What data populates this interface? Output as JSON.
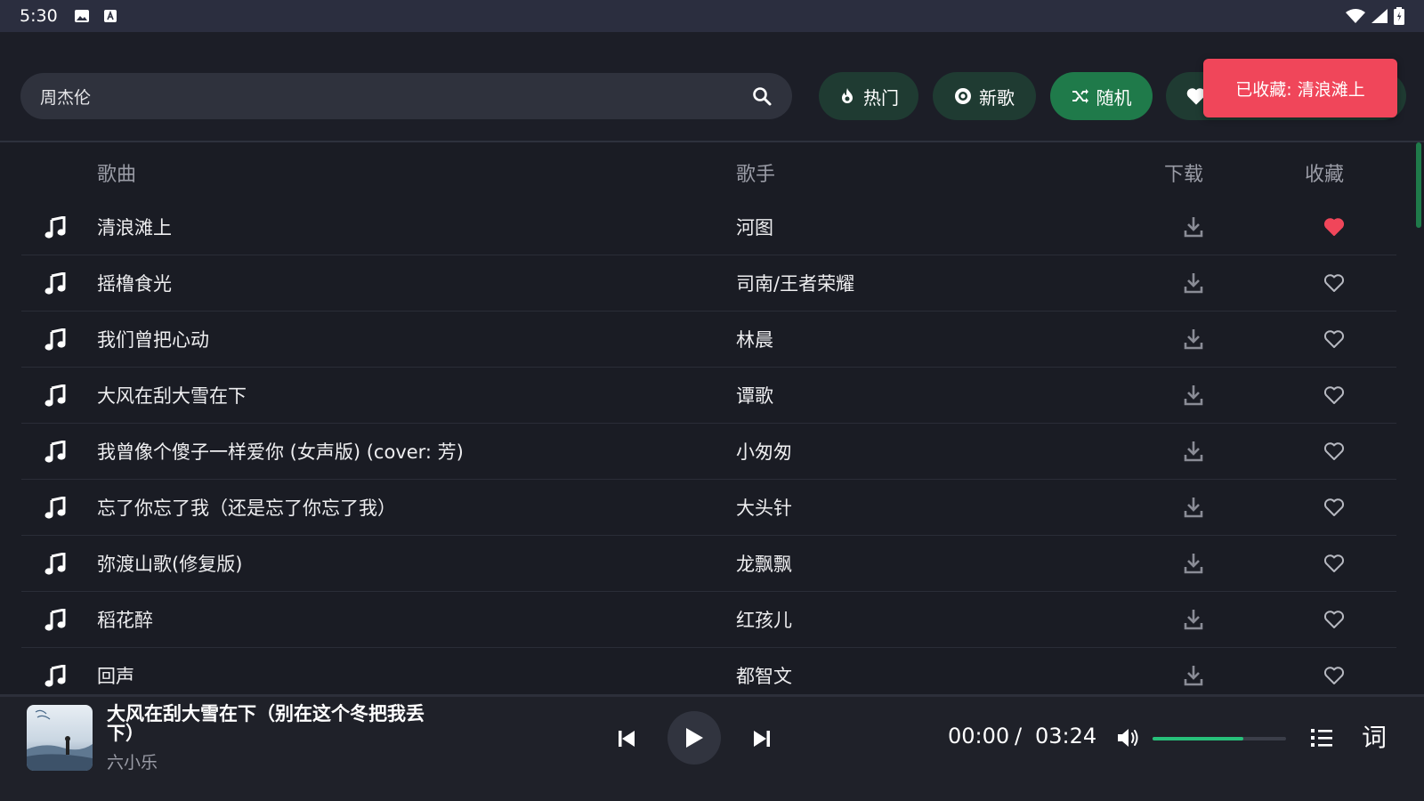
{
  "status_bar": {
    "time": "5:30"
  },
  "search": {
    "value": "周杰伦"
  },
  "filters": [
    {
      "label": "热门",
      "icon": "fire-icon"
    },
    {
      "label": "新歌",
      "icon": "disc-icon"
    },
    {
      "label": "随机",
      "icon": "shuffle-icon",
      "active": true
    },
    {
      "label": "",
      "icon": "heart-icon"
    }
  ],
  "toast": {
    "text": "已收藏: 清浪滩上"
  },
  "table": {
    "headers": {
      "song": "歌曲",
      "artist": "歌手",
      "download": "下载",
      "favorite": "收藏"
    },
    "rows": [
      {
        "title": "清浪滩上",
        "artist": "河图",
        "favorited": true
      },
      {
        "title": "摇橹食光",
        "artist": "司南/王者荣耀",
        "favorited": false
      },
      {
        "title": "我们曾把心动",
        "artist": "林晨",
        "favorited": false
      },
      {
        "title": "大风在刮大雪在下",
        "artist": "谭歌",
        "favorited": false
      },
      {
        "title": "我曾像个傻子一样爱你 (女声版) (cover: 芳)",
        "artist": "小匆匆",
        "favorited": false
      },
      {
        "title": "忘了你忘了我（还是忘了你忘了我）",
        "artist": "大头针",
        "favorited": false
      },
      {
        "title": "弥渡山歌(修复版)",
        "artist": "龙飘飘",
        "favorited": false
      },
      {
        "title": "稻花醉",
        "artist": "红孩儿",
        "favorited": false
      },
      {
        "title": "回声",
        "artist": "都智文",
        "favorited": false
      }
    ]
  },
  "player": {
    "title": "大风在刮大雪在下（别在这个冬把我丢下）",
    "artist": "六小乐",
    "current_time": "00:00",
    "separator": "/",
    "total_time": "03:24",
    "volume": 0.68,
    "lyrics_label": "词"
  },
  "colors": {
    "accent": "#1f7a4a",
    "toast": "#f0465a",
    "favorite": "#f0465a",
    "volume": "#27c07a"
  }
}
